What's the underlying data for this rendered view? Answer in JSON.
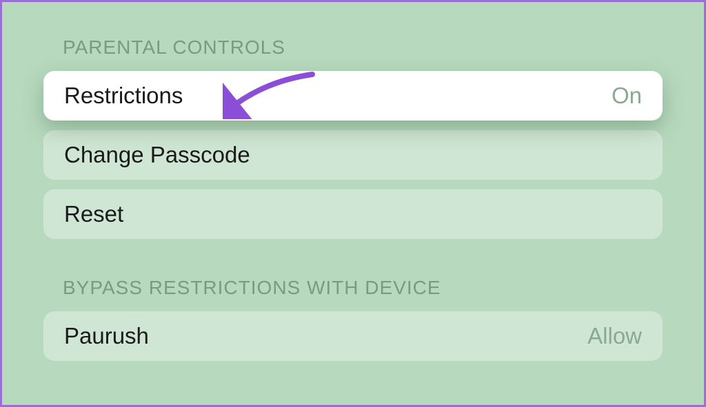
{
  "sections": {
    "parental_controls": {
      "header": "PARENTAL CONTROLS",
      "rows": {
        "restrictions": {
          "label": "Restrictions",
          "value": "On"
        },
        "change_passcode": {
          "label": "Change Passcode"
        },
        "reset": {
          "label": "Reset"
        }
      }
    },
    "bypass": {
      "header": "BYPASS RESTRICTIONS WITH DEVICE",
      "rows": {
        "device": {
          "label": "Paurush",
          "value": "Allow"
        }
      }
    }
  },
  "annotation": {
    "arrow_color": "#8a4fd6"
  }
}
